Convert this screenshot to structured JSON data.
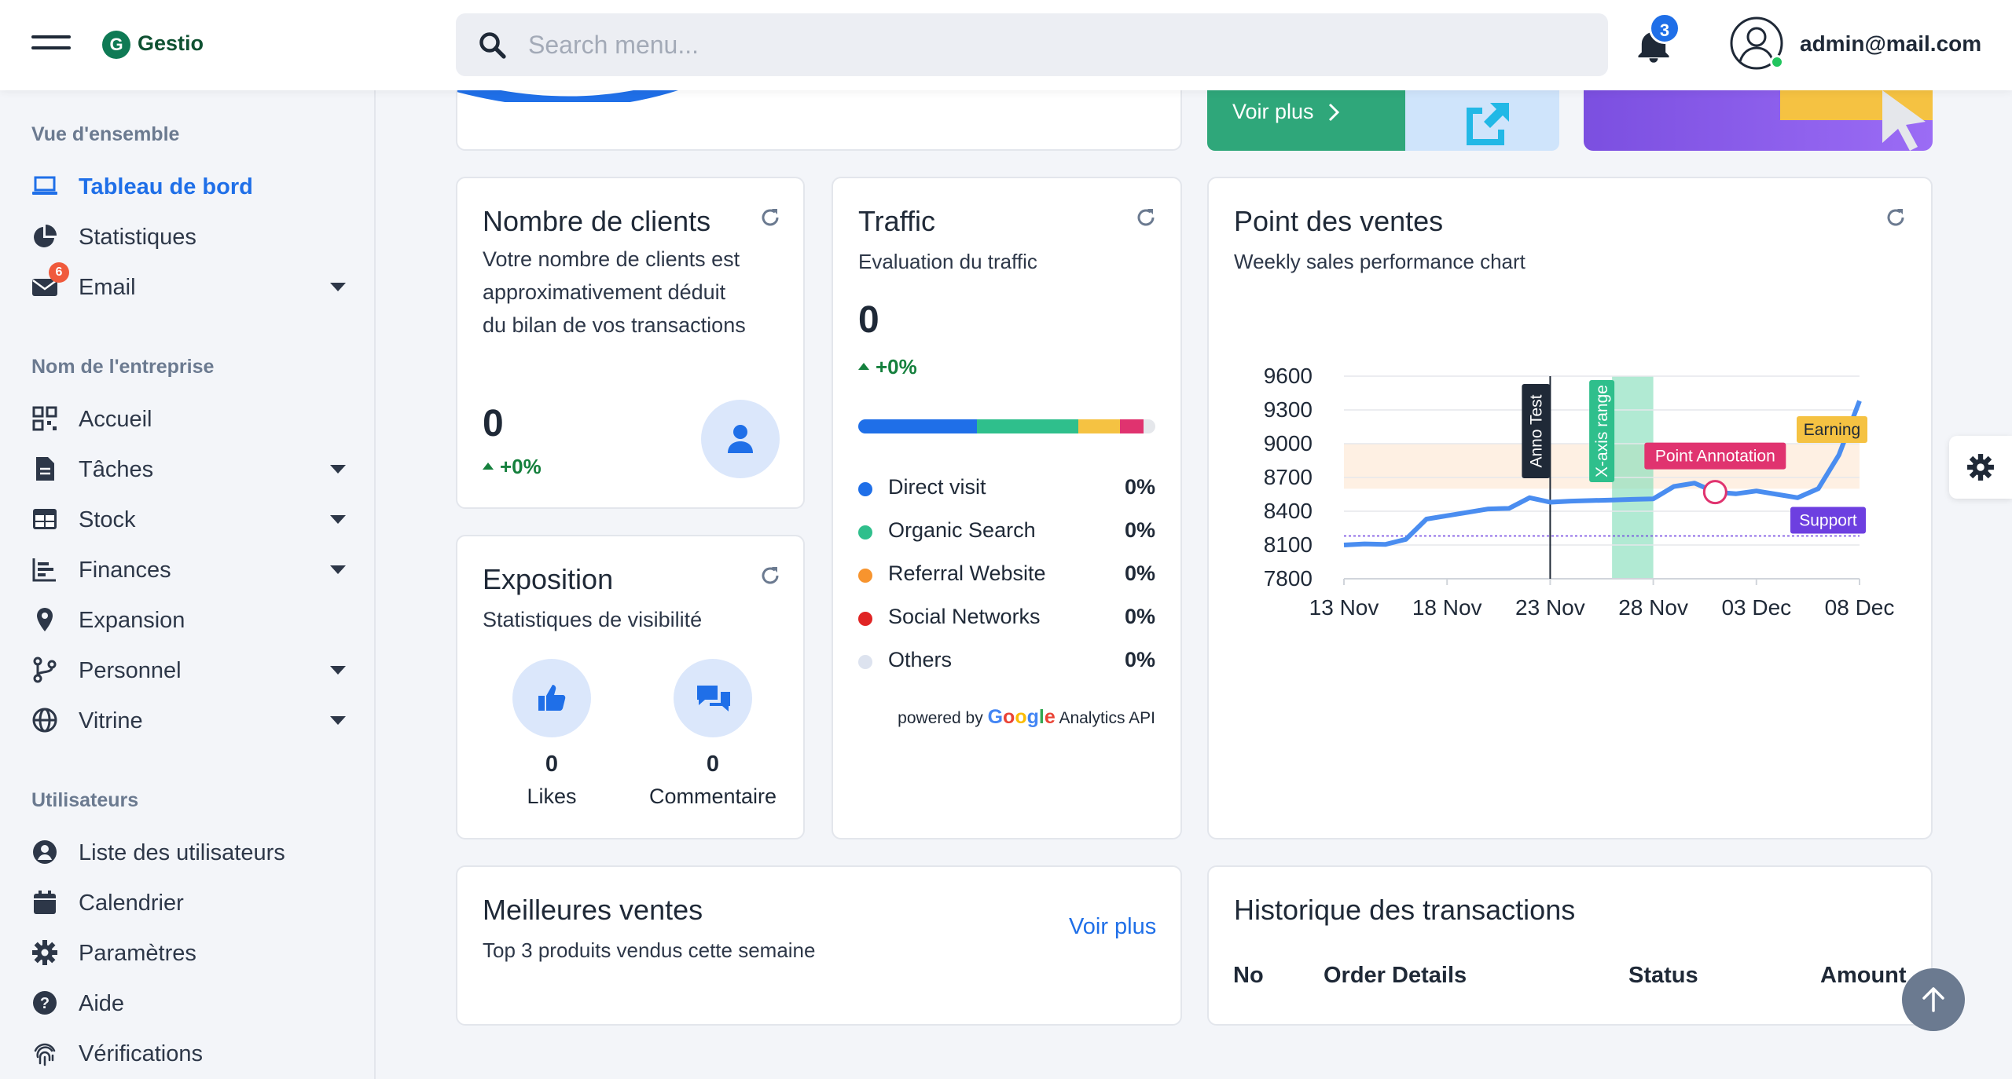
{
  "header": {
    "logo_letter": "G",
    "app_name": "Gestio",
    "search_placeholder": "Search menu...",
    "notification_count": "3",
    "user_email": "admin@mail.com"
  },
  "sidebar": {
    "sections": [
      {
        "title": "Vue d'ensemble"
      },
      {
        "title": "Nom de l'entreprise"
      },
      {
        "title": "Utilisateurs"
      }
    ],
    "overview": [
      {
        "label": "Tableau de bord",
        "icon": "laptop-icon",
        "active": true
      },
      {
        "label": "Statistiques",
        "icon": "pie-chart-icon"
      },
      {
        "label": "Email",
        "icon": "envelope-icon",
        "badge": "6",
        "expandable": true
      }
    ],
    "company": [
      {
        "label": "Accueil",
        "icon": "qrcode-icon"
      },
      {
        "label": "Tâches",
        "icon": "file-icon",
        "expandable": true
      },
      {
        "label": "Stock",
        "icon": "table-icon",
        "expandable": true
      },
      {
        "label": "Finances",
        "icon": "bar-chart-icon",
        "expandable": true
      },
      {
        "label": "Expansion",
        "icon": "map-pin-icon"
      },
      {
        "label": "Personnel",
        "icon": "branch-icon",
        "expandable": true
      },
      {
        "label": "Vitrine",
        "icon": "globe-icon",
        "expandable": true
      }
    ],
    "users": [
      {
        "label": "Liste des utilisateurs",
        "icon": "user-circle-icon"
      },
      {
        "label": "Calendrier",
        "icon": "calendar-icon"
      },
      {
        "label": "Paramètres",
        "icon": "gear-icon"
      },
      {
        "label": "Aide",
        "icon": "question-icon"
      },
      {
        "label": "Vérifications",
        "icon": "fingerprint-icon"
      }
    ]
  },
  "promo": {
    "voir_plus": "Voir plus"
  },
  "clients_card": {
    "title": "Nombre de clients",
    "description": "Votre nombre de clients est approximativement déduit du bilan de vos transactions",
    "value": "0",
    "delta": "+0%"
  },
  "traffic_card": {
    "title": "Traffic",
    "subtitle": "Evaluation du traffic",
    "value": "0",
    "delta": "+0%",
    "bar_segments": [
      {
        "color": "#1f6fe8",
        "fraction": 0.4
      },
      {
        "color": "#2fbf8c",
        "fraction": 0.34
      },
      {
        "color": "#f5c242",
        "fraction": 0.14
      },
      {
        "color": "#e0336f",
        "fraction": 0.08
      },
      {
        "color": "#e5e7eb",
        "fraction": 0.04
      }
    ],
    "legend": [
      {
        "name": "Direct visit",
        "pct": "0%",
        "color": "#1f6fe8"
      },
      {
        "name": "Organic Search",
        "pct": "0%",
        "color": "#2fbf8c"
      },
      {
        "name": "Referral Website",
        "pct": "0%",
        "color": "#f7942e"
      },
      {
        "name": "Social Networks",
        "pct": "0%",
        "color": "#e02424"
      },
      {
        "name": "Others",
        "pct": "0%",
        "color": "#dde3ef"
      }
    ],
    "powered_by": "powered by",
    "google": "Google",
    "analytics_api": "Analytics API"
  },
  "exposition_card": {
    "title": "Exposition",
    "subtitle": "Statistiques de visibilité",
    "likes_value": "0",
    "likes_label": "Likes",
    "comments_value": "0",
    "comments_label": "Commentaire"
  },
  "sales_card": {
    "title": "Point des ventes",
    "subtitle": "Weekly sales performance chart"
  },
  "chart_data": {
    "type": "line",
    "title": "Point des ventes",
    "subtitle": "Weekly sales performance chart",
    "x_ticks": [
      "13 Nov",
      "18 Nov",
      "23 Nov",
      "28 Nov",
      "03 Dec",
      "08 Dec"
    ],
    "y_ticks": [
      "9600",
      "9300",
      "9000",
      "8700",
      "8400",
      "8100",
      "7800"
    ],
    "ylim": [
      7800,
      9600
    ],
    "x": [
      "13 Nov",
      "14 Nov",
      "15 Nov",
      "16 Nov",
      "17 Nov",
      "18 Nov",
      "19 Nov",
      "20 Nov",
      "21 Nov",
      "22 Nov",
      "23 Nov",
      "24 Nov",
      "25 Nov",
      "26 Nov",
      "27 Nov",
      "28 Nov",
      "29 Nov",
      "30 Nov",
      "01 Dec",
      "02 Dec",
      "03 Dec",
      "04 Dec",
      "05 Dec",
      "06 Dec",
      "07 Dec",
      "08 Dec"
    ],
    "values": [
      8100,
      8110,
      8105,
      8150,
      8330,
      8360,
      8390,
      8420,
      8425,
      8520,
      8480,
      8490,
      8495,
      8500,
      8505,
      8510,
      8620,
      8650,
      8570,
      8555,
      8580,
      8550,
      8520,
      8600,
      8900,
      9380
    ],
    "annotations": {
      "x_line": {
        "x": "23 Nov",
        "label": "Anno Test"
      },
      "x_range": {
        "from": "26 Nov",
        "to": "28 Nov",
        "label": "X-axis range"
      },
      "y_range": {
        "from": 8600,
        "to": 9000,
        "label": "Earning"
      },
      "y_line": {
        "y": 8180,
        "label": "Support"
      },
      "point": {
        "x": "01 Dec",
        "y": 8570,
        "label": "Point Annotation"
      }
    }
  },
  "best_sales_card": {
    "title": "Meilleures ventes",
    "subtitle": "Top 3 produits vendus cette semaine",
    "link": "Voir plus"
  },
  "transactions_card": {
    "title": "Historique des transactions",
    "columns": [
      "No",
      "Order Details",
      "Status",
      "Amount"
    ]
  }
}
